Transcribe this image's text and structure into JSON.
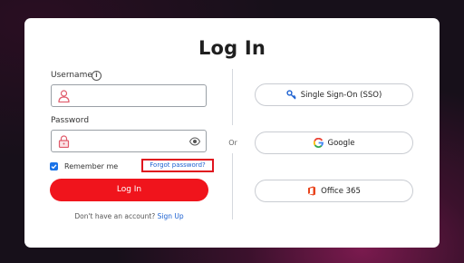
{
  "page": {
    "title": "Log In"
  },
  "form": {
    "username_label": "Username",
    "username_value": "",
    "password_label": "Password",
    "password_value": "",
    "remember_label": "Remember me",
    "remember_checked": true,
    "forgot_label": "Forgot password?",
    "login_label": "Log In",
    "no_account_text": "Don't have an account?",
    "signup_label": "Sign Up"
  },
  "divider": {
    "or_label": "Or"
  },
  "providers": [
    {
      "label": "Single Sign-On (SSO)",
      "icon": "key-icon"
    },
    {
      "label": "Google",
      "icon": "google-icon"
    },
    {
      "label": "Office 365",
      "icon": "office-icon"
    }
  ],
  "colors": {
    "accent_red": "#f0141c",
    "link_blue": "#1a5fd0",
    "checkbox_blue": "#1a73e8",
    "highlight_border": "#e0141e",
    "input_icon_pink": "#e05a6a"
  }
}
